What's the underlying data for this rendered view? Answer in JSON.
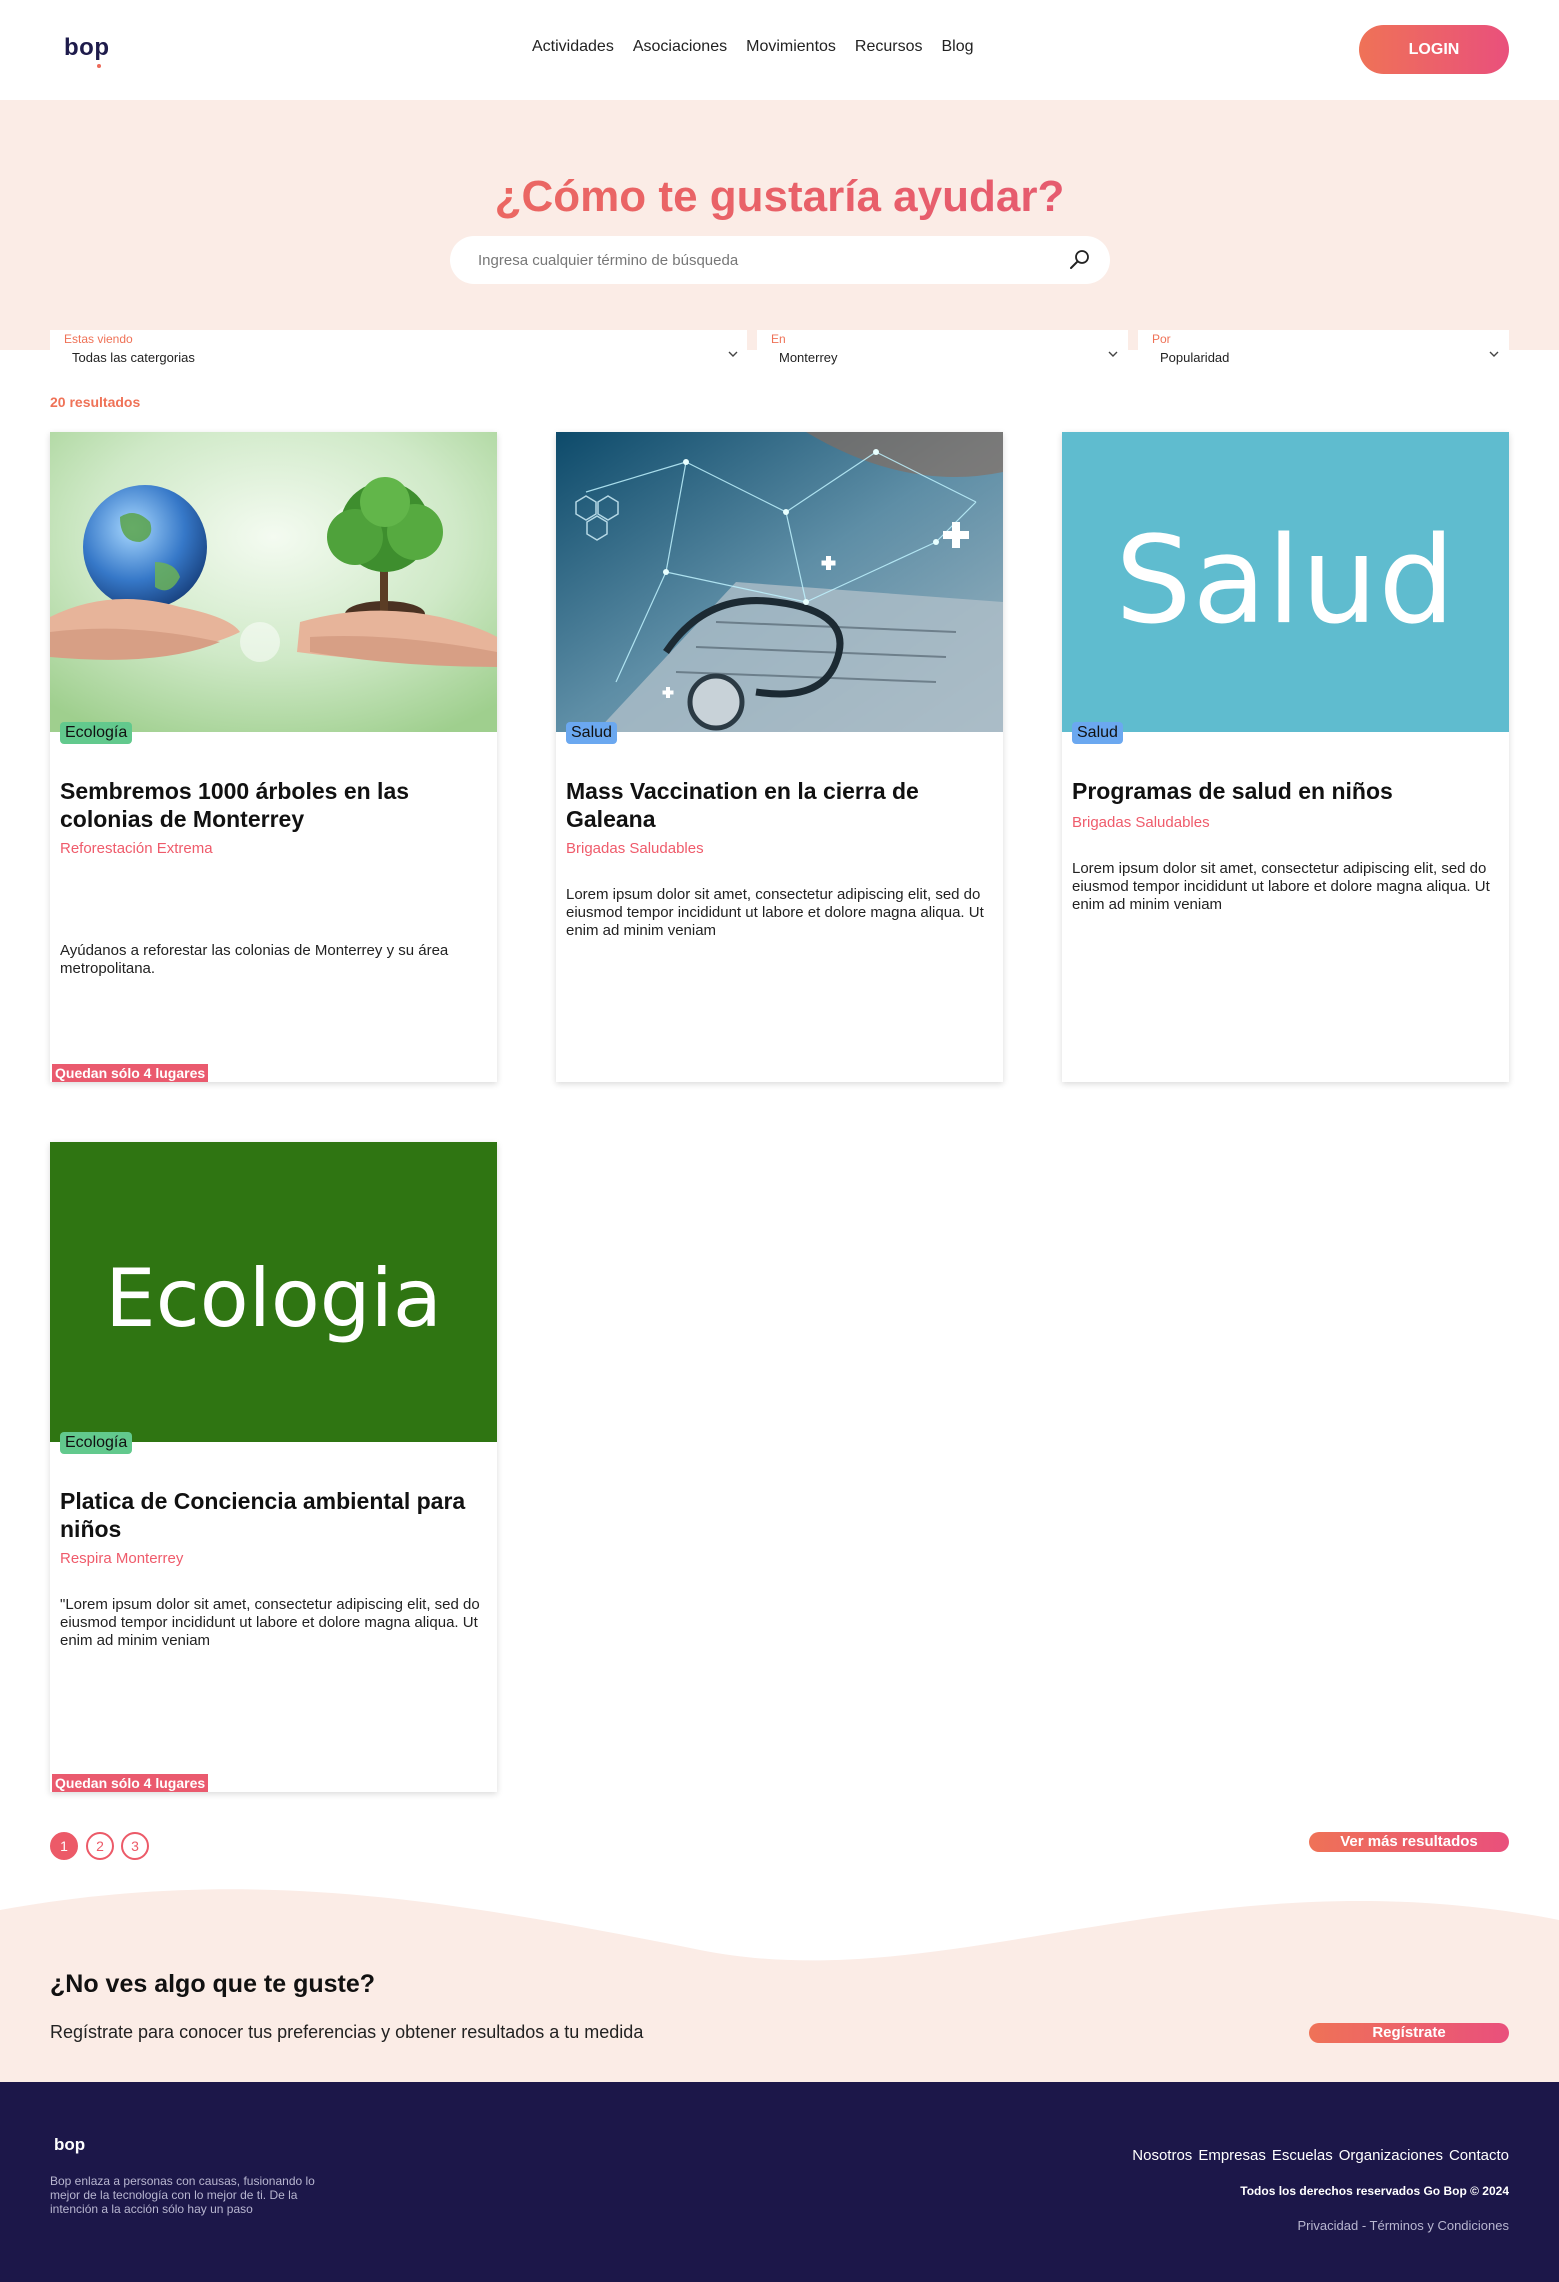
{
  "header": {
    "logo": "bop",
    "nav": [
      "Actividades",
      "Asociaciones",
      "Movimientos",
      "Recursos",
      "Blog"
    ],
    "login_label": "LOGIN"
  },
  "hero": {
    "title": "¿Cómo te gustaría ayudar?",
    "search_placeholder": "Ingresa cualquier término de búsqueda"
  },
  "filters": [
    {
      "label": "Estas viendo",
      "value": "Todas las catergorias"
    },
    {
      "label": "En",
      "value": "Monterrey"
    },
    {
      "label": "Por",
      "value": "Popularidad"
    }
  ],
  "results_count": "20 resultados",
  "cards": [
    {
      "image": "earth-and-tree-in-hands",
      "tag": "Ecología",
      "title": "Sembremos 1000 árboles en las colonias de Monterrey",
      "org": "Reforestación Extrema",
      "description": "Ayúdanos a reforestar las colonias de Monterrey y su área metropolitana.",
      "badge": "Quedan sólo 4 lugares"
    },
    {
      "image": "stethoscope-laptop-network",
      "tag": "Salud",
      "title": "Mass Vaccination en la cierra de Galeana",
      "org": "Brigadas Saludables",
      "description": "Lorem ipsum dolor sit amet, consectetur adipiscing elit, sed do eiusmod tempor incididunt ut labore et dolore magna aliqua. Ut enim ad minim veniam",
      "badge": ""
    },
    {
      "image": "salud-banner",
      "image_text": "Salud",
      "tag": "Salud",
      "title": "Programas de salud en niños",
      "org": "Brigadas Saludables",
      "description": "Lorem ipsum dolor sit amet, consectetur adipiscing elit, sed do eiusmod tempor incididunt ut labore et dolore magna aliqua. Ut enim ad minim veniam",
      "badge": ""
    },
    {
      "image": "ecologia-banner",
      "image_text": "Ecologia",
      "tag": "Ecología",
      "title": "Platica de Conciencia ambiental para niños",
      "org": "Respira Monterrey",
      "description": "\"Lorem ipsum dolor sit amet, consectetur adipiscing elit, sed do eiusmod tempor incididunt ut labore et dolore magna aliqua. Ut enim ad minim veniam",
      "badge": "Quedan sólo 4 lugares"
    }
  ],
  "pagination": {
    "pages": [
      "1",
      "2",
      "3"
    ],
    "current": "1",
    "more_label": "Ver más resultados"
  },
  "cta": {
    "title": "¿No ves algo que te guste?",
    "text": "Regístrate para conocer tus preferencias y obtener resultados a tu medida",
    "button_label": "Regístrate"
  },
  "footer": {
    "logo": "bop",
    "about": "Bop enlaza a personas con causas, fusionando lo mejor de la tecnología con lo mejor de ti. De la intención a la acción sólo hay un paso",
    "links": [
      "Nosotros",
      "Empresas",
      "Escuelas",
      "Organizaciones",
      "Contacto"
    ],
    "rights": "Todos los derechos reservados Go Bop © 2024",
    "privacy": "Privacidad",
    "separator": " - ",
    "terms": "Términos y Condiciones"
  },
  "colors": {
    "accent_start": "#ef7257",
    "accent_end": "#e9507c",
    "hero_bg": "#fbece6",
    "footer_bg": "#1c1749",
    "tag_ecologia": "#62c98d",
    "tag_salud": "#6ba8f0",
    "salud_banner": "#5fbccf",
    "ecologia_banner": "#2f7512"
  }
}
